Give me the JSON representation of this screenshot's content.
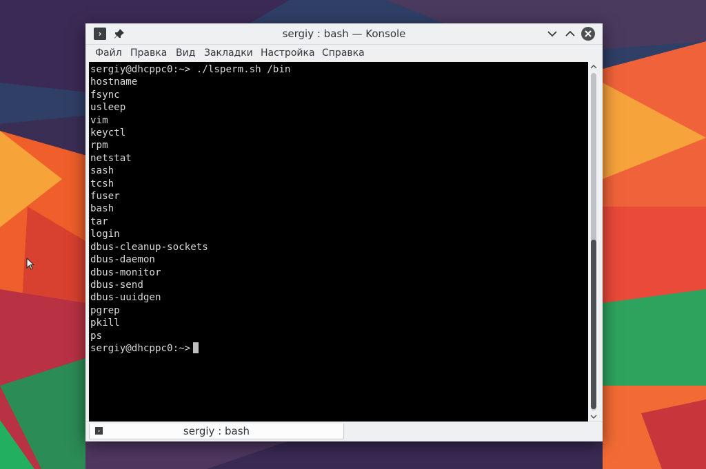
{
  "window": {
    "title": "sergiy : bash — Konsole",
    "app_icon_glyph": "›",
    "icons": [
      "konsole-app-icon",
      "pin-icon",
      "minimize-chevron-down-icon",
      "maximize-chevron-up-icon",
      "close-x-icon"
    ]
  },
  "menubar": {
    "items": [
      "Файл",
      "Правка",
      "Вид",
      "Закладки",
      "Настройка",
      "Справка"
    ]
  },
  "terminal": {
    "lines": [
      "sergiy@dhcppc0:~> ./lsperm.sh /bin",
      "hostname",
      "fsync",
      "usleep",
      "vim",
      "keyctl",
      "rpm",
      "netstat",
      "sash",
      "tcsh",
      "fuser",
      "bash",
      "tar",
      "login",
      "dbus-cleanup-sockets",
      "dbus-daemon",
      "dbus-monitor",
      "dbus-send",
      "dbus-uuidgen",
      "pgrep",
      "pkill",
      "ps"
    ],
    "prompt": "sergiy@dhcppc0:~>"
  },
  "tabs": [
    {
      "label": "sergiy : bash"
    }
  ],
  "colors": {
    "window_bg": "#eff0f1",
    "terminal_bg": "#000000",
    "terminal_fg": "#d8d8d8",
    "close_button": "#4d5053"
  }
}
